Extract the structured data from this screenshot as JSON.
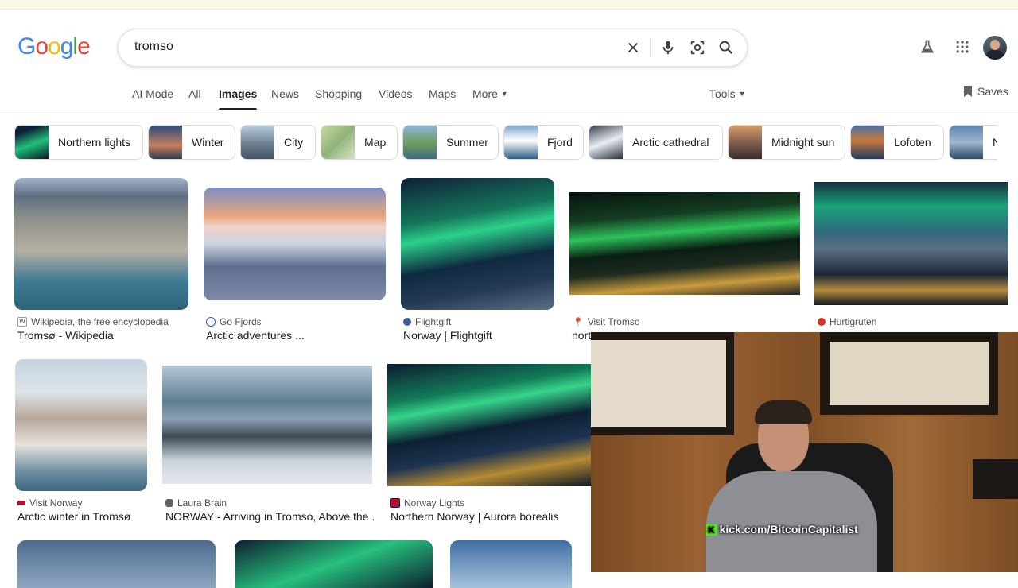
{
  "logo": "Google",
  "search": {
    "value": "tromso"
  },
  "tabs": [
    "AI Mode",
    "All",
    "Images",
    "News",
    "Shopping",
    "Videos",
    "Maps",
    "More"
  ],
  "active_tab": "Images",
  "tools_label": "Tools",
  "saves_label": "Saves",
  "chips": [
    "Northern lights",
    "Winter",
    "City",
    "Map",
    "Summer",
    "Fjord",
    "Arctic cathedral",
    "Midnight sun",
    "Lofoten",
    "N"
  ],
  "results_row1": [
    {
      "source": "Wikipedia, the free encyclopedia",
      "title": "Tromsø - Wikipedia"
    },
    {
      "source": "Go Fjords",
      "title": "Arctic adventures ..."
    },
    {
      "source": "Flightgift",
      "title": "Norway | Flightgift"
    },
    {
      "source": "Visit Tromso",
      "title": "north..."
    },
    {
      "source": "Hurtigruten",
      "title": ""
    }
  ],
  "results_row2": [
    {
      "source": "Visit Norway",
      "title": "Arctic winter in Tromsø"
    },
    {
      "source": "Laura Brain",
      "title": "NORWAY - Arriving in Tromso, Above the ..."
    },
    {
      "source": "Norway Lights",
      "title": "Northern Norway | Aurora borealis"
    }
  ],
  "overlay": {
    "stream_url": "kick.com/BitcoinCapitalist"
  }
}
